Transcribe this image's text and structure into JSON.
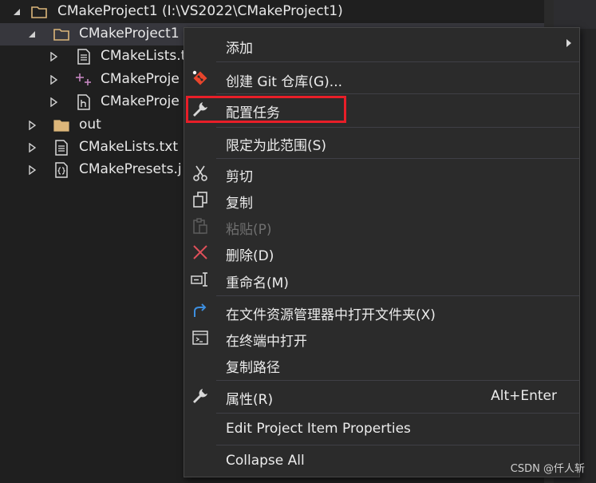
{
  "tree": {
    "rows": [
      {
        "label": "CMakeProject1 (I:\\VS2022\\CMakeProject1)",
        "icon": "folder-icon",
        "expanded": true
      },
      {
        "label": "CMakeProject1",
        "icon": "folder-icon",
        "expanded": true,
        "selected": true
      },
      {
        "label": "CMakeLists.t",
        "icon": "document-icon",
        "expanded": false
      },
      {
        "label": "CMakeProje",
        "icon": "cpp-source-icon",
        "expanded": false
      },
      {
        "label": "CMakeProje",
        "icon": "header-file-icon",
        "expanded": false
      },
      {
        "label": "out",
        "icon": "folder-icon",
        "expanded": false
      },
      {
        "label": "CMakeLists.txt",
        "icon": "document-icon",
        "expanded": false
      },
      {
        "label": "CMakePresets.j",
        "icon": "json-file-icon",
        "expanded": false
      }
    ]
  },
  "context_menu": {
    "items": [
      {
        "label": "添加",
        "icon": "",
        "submenu": true
      },
      {
        "label": "创建 Git 仓库(G)...",
        "icon": "git-icon"
      },
      {
        "label": "配置任务",
        "icon": "wrench-icon",
        "highlighted": true
      },
      {
        "label": "限定为此范围(S)",
        "icon": ""
      },
      {
        "label": "剪切",
        "icon": "scissors-icon"
      },
      {
        "label": "复制",
        "icon": "copy-icon"
      },
      {
        "label": "粘贴(P)",
        "icon": "paste-icon",
        "disabled": true
      },
      {
        "label": "删除(D)",
        "icon": "delete-x-icon"
      },
      {
        "label": "重命名(M)",
        "icon": "rename-icon"
      },
      {
        "label": "在文件资源管理器中打开文件夹(X)",
        "icon": "open-folder-arrow-icon"
      },
      {
        "label": "在终端中打开",
        "icon": "terminal-icon"
      },
      {
        "label": "复制路径",
        "icon": ""
      },
      {
        "label": "属性(R)",
        "icon": "wrench-icon",
        "shortcut": "Alt+Enter"
      },
      {
        "label": "Edit Project Item Properties",
        "icon": ""
      },
      {
        "label": "Collapse All",
        "icon": ""
      }
    ]
  },
  "watermark": "CSDN @仟人斩",
  "colors": {
    "background": "#1f1f1f",
    "menu_background": "#2b2b2b",
    "highlight_border": "#e81e28",
    "selected_row": "#37373d"
  }
}
